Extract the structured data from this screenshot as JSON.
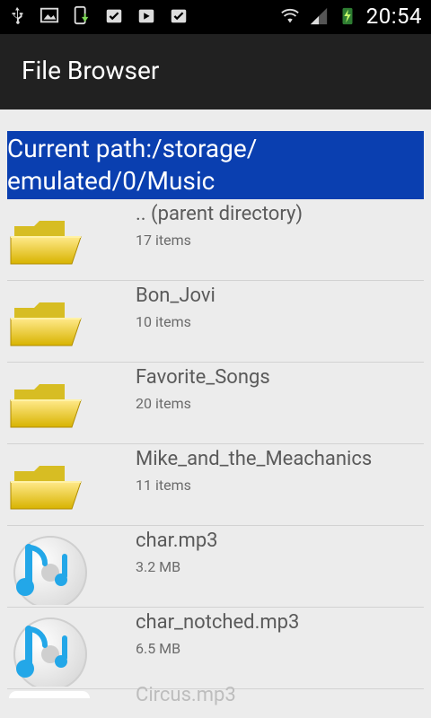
{
  "status_bar": {
    "time": "20:54",
    "left_icons": [
      "usb-icon",
      "image-icon",
      "phone-update-icon",
      "clipboard-check-icon",
      "video-clipboard-icon",
      "clipboard-check-icon"
    ],
    "right_icons": [
      "wifi-icon",
      "signal-icon",
      "battery-charging-icon"
    ]
  },
  "action_bar": {
    "title": "File Browser"
  },
  "path": {
    "text": "Current path:/storage/ emulated/0/Music",
    "color": "#0a3fb0"
  },
  "items": [
    {
      "name": ".. (parent directory)",
      "meta": "17 items",
      "icon": "folder-icon"
    },
    {
      "name": "Bon_Jovi",
      "meta": "10 items",
      "icon": "folder-icon"
    },
    {
      "name": "Favorite_Songs",
      "meta": "20 items",
      "icon": "folder-icon"
    },
    {
      "name": "Mike_and_the_Meachanics",
      "meta": "11 items",
      "icon": "folder-icon"
    },
    {
      "name": "char.mp3",
      "meta": "3.2 MB",
      "icon": "music-file-icon"
    },
    {
      "name": "char_notched.mp3",
      "meta": "6.5 MB",
      "icon": "music-file-icon"
    }
  ],
  "partial_item": {
    "name": "Circus.mp3"
  }
}
